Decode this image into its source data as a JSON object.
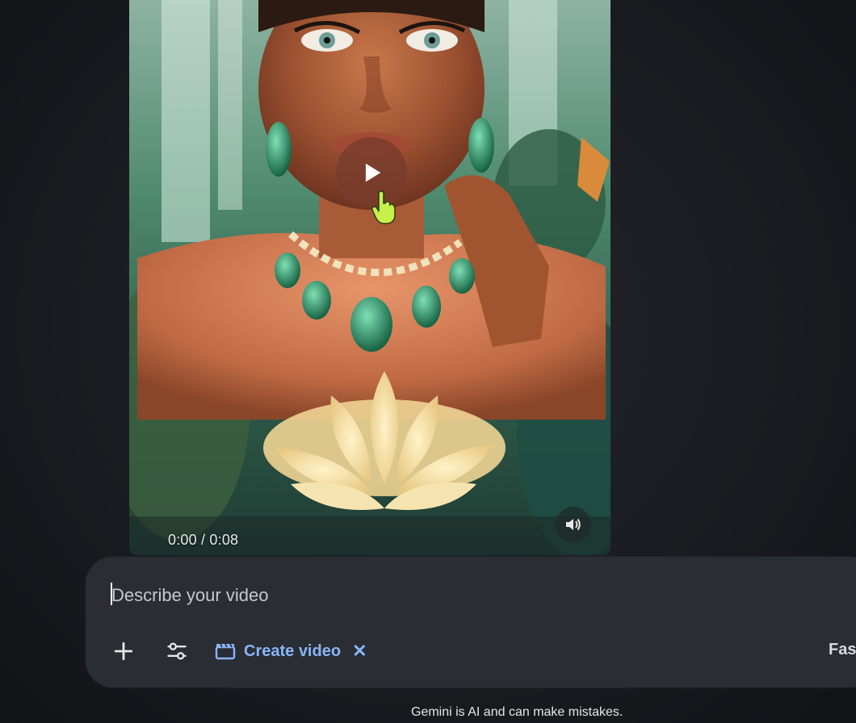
{
  "video": {
    "time_readout": "0:00 / 0:08",
    "play_icon": "play-icon",
    "volume_icon": "volume-icon",
    "cursor_icon": "hand-pointer-icon"
  },
  "prompt": {
    "placeholder": "Describe your video",
    "value": ""
  },
  "toolbar": {
    "add_icon": "plus-icon",
    "tools_icon": "sliders-icon",
    "chip_icon": "clapperboard-icon",
    "chip_label": "Create video",
    "chip_close": "✕",
    "mode_label": "Fast"
  },
  "footer": {
    "disclaimer": "Gemini is AI and can make mistakes."
  },
  "colors": {
    "background": "#1a1c21",
    "prompt_box": "#2a2d33",
    "accent": "#8ab4f8",
    "text": "#e6e6e6"
  }
}
